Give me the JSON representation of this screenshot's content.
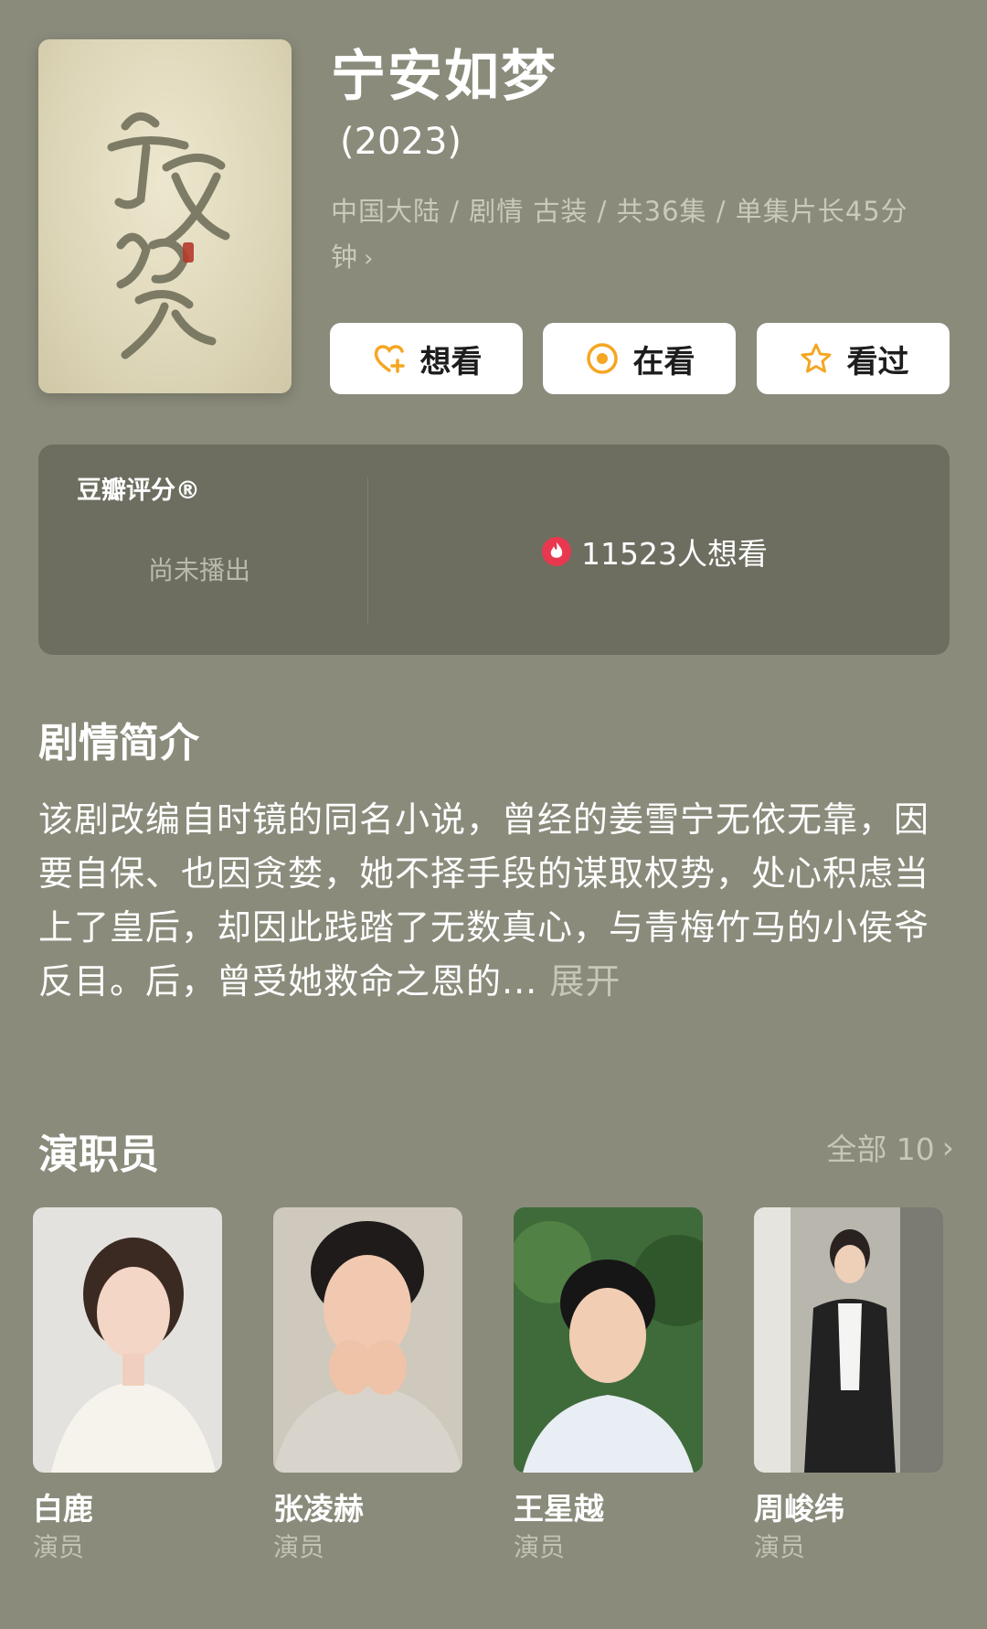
{
  "show": {
    "title": "宁安如梦",
    "year": "(2023)",
    "meta_line": "中国大陆 / 剧情 古装 / 共36集 / 单集片长45分钟",
    "poster_calligraphy": "宁安如梦"
  },
  "actions": {
    "want": "想看",
    "watching": "在看",
    "watched": "看过"
  },
  "rating": {
    "title": "豆瓣评分®",
    "status": "尚未播出",
    "wish_count": "11523人想看"
  },
  "synopsis": {
    "heading": "剧情简介",
    "text": "该剧改编自时镜的同名小说，曾经的姜雪宁无依无靠，因要自保、也因贪婪，她不择手段的谋取权势，处心积虑当上了皇后，却因此践踏了无数真心，与青梅竹马的小侯爷反目。后，曾受她救命之恩的...",
    "expand": "展开"
  },
  "cast": {
    "heading": "演职员",
    "all_label": "全部 10",
    "members": [
      {
        "name": "白鹿",
        "role": "演员"
      },
      {
        "name": "张凌赫",
        "role": "演员"
      },
      {
        "name": "王星越",
        "role": "演员"
      },
      {
        "name": "周峻纬",
        "role": "演员"
      }
    ]
  },
  "colors": {
    "background": "#8a8b7b",
    "card": "#6d6e60",
    "accent_orange": "#f5a623",
    "fire_red": "#e8384f"
  }
}
